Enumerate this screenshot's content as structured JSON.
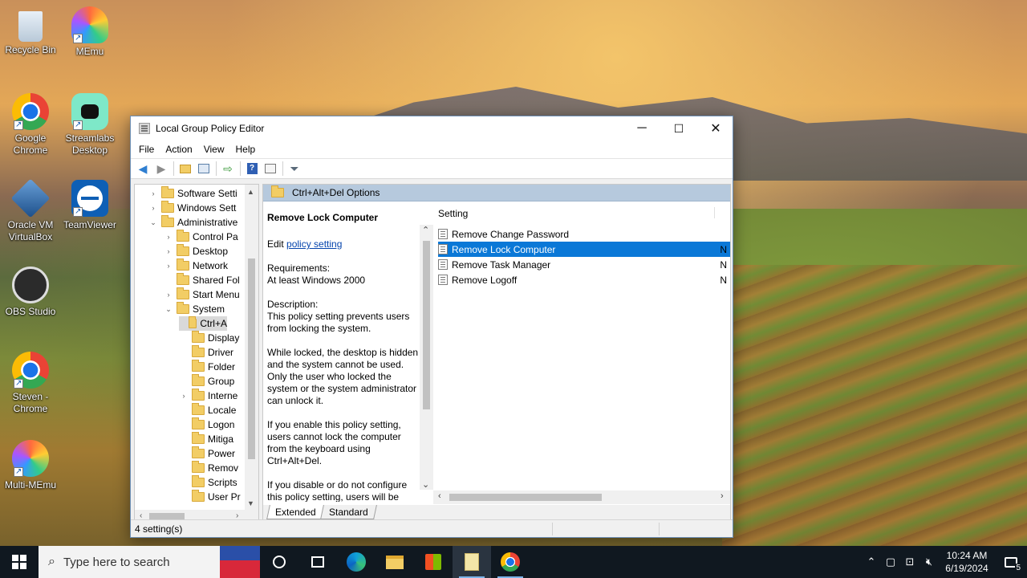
{
  "desktop": {
    "icons": [
      {
        "label": "Recycle Bin"
      },
      {
        "label": "MEmu"
      },
      {
        "label": "Google Chrome"
      },
      {
        "label": "Streamlabs Desktop"
      },
      {
        "label": "Oracle VM VirtualBox"
      },
      {
        "label": "TeamViewer"
      },
      {
        "label": "OBS Studio"
      },
      {
        "label": "Steven - Chrome"
      },
      {
        "label": "Multi-MEmu"
      }
    ]
  },
  "window": {
    "title": "Local Group Policy Editor",
    "minimize": "─",
    "maximize": "☐",
    "close": "✕",
    "menu": [
      "File",
      "Action",
      "View",
      "Help"
    ]
  },
  "tree": {
    "items": [
      {
        "label": "Software Setti",
        "expander": "›"
      },
      {
        "label": "Windows Sett",
        "expander": "›"
      },
      {
        "label": "Administrative",
        "expander": "⌄"
      },
      {
        "label": "Control Pa",
        "expander": "›"
      },
      {
        "label": "Desktop",
        "expander": "›"
      },
      {
        "label": "Network",
        "expander": "›"
      },
      {
        "label": "Shared Fol",
        "expander": ""
      },
      {
        "label": "Start Menu",
        "expander": "›"
      },
      {
        "label": "System",
        "expander": "⌄"
      },
      {
        "label": "Ctrl+A",
        "expander": ""
      },
      {
        "label": "Display",
        "expander": ""
      },
      {
        "label": "Driver",
        "expander": ""
      },
      {
        "label": "Folder",
        "expander": ""
      },
      {
        "label": "Group",
        "expander": ""
      },
      {
        "label": "Interne",
        "expander": "›"
      },
      {
        "label": "Locale",
        "expander": ""
      },
      {
        "label": "Logon",
        "expander": ""
      },
      {
        "label": "Mitiga",
        "expander": ""
      },
      {
        "label": "Power",
        "expander": ""
      },
      {
        "label": "Remov",
        "expander": ""
      },
      {
        "label": "Scripts",
        "expander": ""
      },
      {
        "label": "User Pr",
        "expander": ""
      }
    ]
  },
  "details": {
    "header": "Ctrl+Alt+Del Options",
    "policy_title": "Remove Lock Computer",
    "edit_prefix": "Edit",
    "edit_link": "policy setting",
    "requirements": "Requirements:\nAt least Windows 2000",
    "description": "Description:\nThis policy setting prevents users from locking the system.",
    "para1": "While locked, the desktop is hidden and the system cannot be used. Only the user who locked the system or the system administrator can unlock it.",
    "para2": "If you enable this policy setting, users cannot lock the computer from the keyboard using Ctrl+Alt+Del.",
    "para3": "If you disable or do not configure this policy setting, users will be"
  },
  "settings": {
    "column": "Setting",
    "rows": [
      {
        "name": "Remove Change Password",
        "state": ""
      },
      {
        "name": "Remove Lock Computer",
        "state": "N"
      },
      {
        "name": "Remove Task Manager",
        "state": "N"
      },
      {
        "name": "Remove Logoff",
        "state": "N"
      }
    ]
  },
  "tabs": [
    "Extended",
    "Standard"
  ],
  "status": "4 setting(s)",
  "taskbar": {
    "search_placeholder": "Type here to search",
    "time": "10:24 AM",
    "date": "6/19/2024",
    "notifications": "5"
  }
}
